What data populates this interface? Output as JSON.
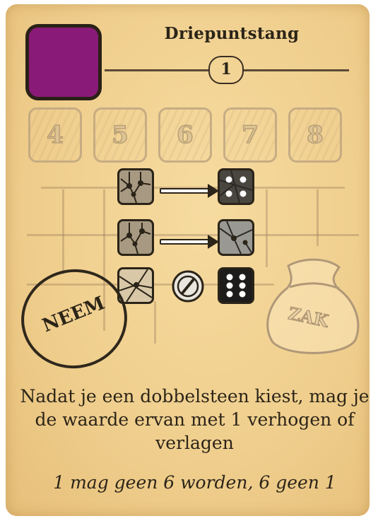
{
  "card": {
    "title": "Driepuntstang",
    "round_number": "1",
    "color_swatch": "#8a1a78",
    "number_boxes": [
      "4",
      "5",
      "6",
      "7",
      "8"
    ],
    "take_stamp": "NEEM",
    "bag_label": "ZAK",
    "description": "Nadat je een dobbelsteen kiest, mag je de waarde ervan met 1 verhogen of verlagen",
    "note": "1 mag geen 6 worden, 6 geen 1",
    "icons": [
      "tool-tile-icon",
      "arrow-right-icon",
      "die-four-dark-icon",
      "die-light-icon",
      "forbidden-icon",
      "die-six-icon"
    ]
  }
}
